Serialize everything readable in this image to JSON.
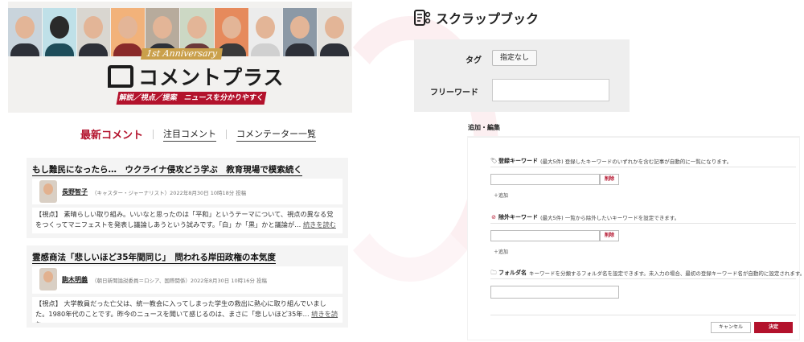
{
  "left": {
    "banner": {
      "anniversary": "1st Anniversary",
      "brand": "コメントプラス",
      "tagline": "解説／視点／提案　ニュースを分かりやすく"
    },
    "tabs": [
      {
        "label": "最新コメント"
      },
      {
        "label": "注目コメント"
      },
      {
        "label": "コメンテーター一覧"
      }
    ],
    "articles": [
      {
        "title": "もし難民になったら…　ウクライナ侵攻どう学ぶ　教育現場で模索続く",
        "author": "長野智子",
        "author_meta": "（キャスター・ジャーナリスト）2022年8月30日 10時18分 投稿",
        "body": "【視点】 素晴らしい取り組み。いいなと思ったのは「平和」というテーマについて、視点の異なる党をつくってマニフェストを発表し議論しあうという試みです。「白」か「黒」かと議論が…",
        "readmore": "続きを読む"
      },
      {
        "title": "霊感商法「悲しいほど35年間同じ」　問われる岸田政権の本気度",
        "author": "駒木明義",
        "author_meta": "（朝日新聞論説委員＝ロシア、国際関係）2022年8月30日 10時16分 投稿",
        "body": "【視点】 大学教員だった亡父は、統一教会に入ってしまった学生の救出に熱心に取り組んでいました。1980年代のことです。昨今のニュースを聞いて感じるのは、まさに「悲しいほど35年…",
        "readmore": "続きを読む"
      }
    ]
  },
  "right": {
    "title": "スクラップブック",
    "filter": {
      "tag_label": "タグ",
      "tag_button": "指定なし",
      "freeword_label": "フリーワード",
      "freeword_value": ""
    },
    "edit_label": "追加・編集",
    "sections": {
      "register": {
        "title": "登録キーワード",
        "limit": "(最大5件)",
        "desc": "登録したキーワードのいずれかを含む記事が自動的に一覧になります。",
        "delete": "削除",
        "add": "追加"
      },
      "exclude": {
        "title": "除外キーワード",
        "limit": "(最大5件)",
        "desc": "一覧から除外したいキーワードを設定できます。",
        "delete": "削除",
        "add": "追加"
      },
      "folder": {
        "title": "フォルダ名",
        "desc": "キーワードを分類するフォルダ名を設定できます。未入力の場合、最初の登録キーワード名が自動的に設定されます。"
      }
    },
    "buttons": {
      "cancel": "キャンセル",
      "ok": "決定"
    }
  },
  "colors": {
    "accent": "#b3122c",
    "gold": "#caa04b",
    "panel_bg": "#eeeeee"
  }
}
